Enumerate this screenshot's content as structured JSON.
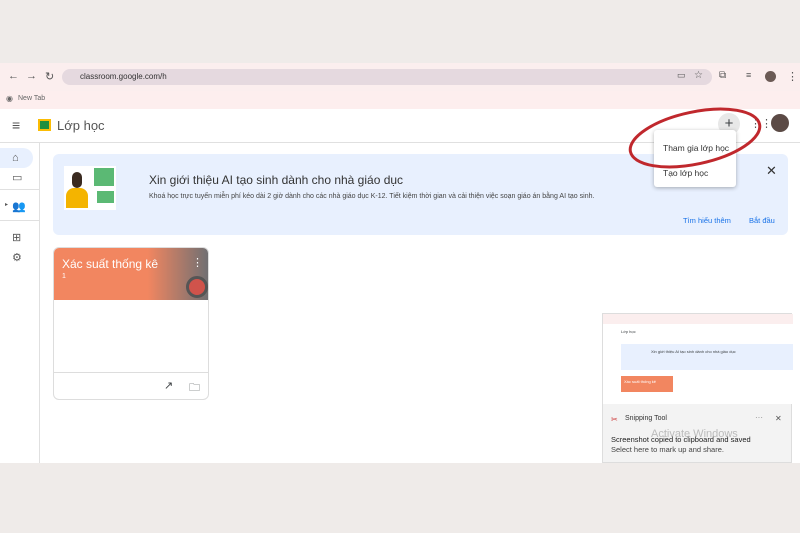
{
  "browser": {
    "url": "classroom.google.com/h",
    "bookmark": "New Tab"
  },
  "app": {
    "title": "Lớp học"
  },
  "menu": {
    "items": [
      "Tham gia lớp học",
      "Tạo lớp học"
    ]
  },
  "banner": {
    "title": "Xin giới thiệu AI tạo sinh dành cho nhà giáo dục",
    "description": "Khoá học trực tuyến miễn phí kéo dài 2 giờ dành cho các nhà giáo dục K-12. Tiết kiệm thời gian và cải thiện việc soạn giáo án bằng AI tạo sinh.",
    "learn_more": "Tìm hiểu thêm",
    "start": "Bắt đầu"
  },
  "card": {
    "title": "Xác suất thống kê",
    "section": "1"
  },
  "toast": {
    "app": "Snipping Tool",
    "line1": "Screenshot copied to clipboard and saved",
    "line2": "Select here to mark up and share.",
    "watermark": "Activate Windows",
    "preview_title": "Lớp học",
    "preview_banner": "Xin giới thiệu AI tạo sinh dành cho nhà giáo dục",
    "preview_card": "Xác suất thống kê"
  },
  "colors": {
    "accent": "#1a73e8",
    "card": "#f28660",
    "annotation": "#c0282d"
  }
}
